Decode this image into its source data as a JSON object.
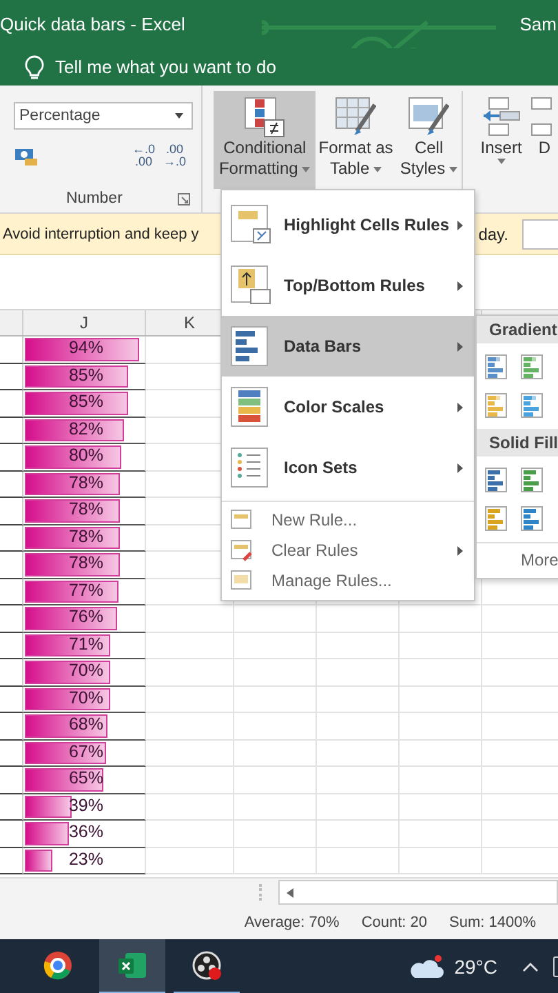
{
  "window": {
    "title": "Quick data bars  -  Excel",
    "user": "Sam"
  },
  "tell_me": {
    "placeholder": "Tell me what you want to do"
  },
  "ribbon": {
    "number_format": {
      "value": "Percentage"
    },
    "decimal_buttons": [
      {
        "top": "←.0",
        "bottom": ".00"
      },
      {
        "top": ".00",
        "bottom": "→.0"
      }
    ],
    "group_label": "Number",
    "buttons": [
      {
        "kind": "cf",
        "line1": "Conditional",
        "line2": "Formatting",
        "selected": true
      },
      {
        "kind": "table",
        "line1": "Format as",
        "line2": "Table",
        "selected": false
      },
      {
        "kind": "styles",
        "line1": "Cell",
        "line2": "Styles",
        "selected": false
      },
      {
        "kind": "insert",
        "line1": "Insert",
        "selected": false
      },
      {
        "kind": "delete",
        "line1": "D",
        "selected": false
      }
    ]
  },
  "message_bar": {
    "text": "Avoid interruption and keep y",
    "text_end": "day."
  },
  "sheet": {
    "columns": [
      "J",
      "K"
    ],
    "rows": [
      {
        "value": "94%",
        "level": 0.94
      },
      {
        "value": "85%",
        "level": 0.85
      },
      {
        "value": "85%",
        "level": 0.85
      },
      {
        "value": "82%",
        "level": 0.82
      },
      {
        "value": "80%",
        "level": 0.8
      },
      {
        "value": "78%",
        "level": 0.78
      },
      {
        "value": "78%",
        "level": 0.78
      },
      {
        "value": "78%",
        "level": 0.78
      },
      {
        "value": "78%",
        "level": 0.78
      },
      {
        "value": "77%",
        "level": 0.77
      },
      {
        "value": "76%",
        "level": 0.76
      },
      {
        "value": "71%",
        "level": 0.71
      },
      {
        "value": "70%",
        "level": 0.7
      },
      {
        "value": "70%",
        "level": 0.7
      },
      {
        "value": "68%",
        "level": 0.68
      },
      {
        "value": "67%",
        "level": 0.67
      },
      {
        "value": "65%",
        "level": 0.65
      },
      {
        "value": "39%",
        "level": 0.39
      },
      {
        "value": "36%",
        "level": 0.36
      },
      {
        "value": "23%",
        "level": 0.23
      }
    ]
  },
  "menu": {
    "items": [
      {
        "kind": "highlight",
        "label": "Highlight Cells Rules",
        "submenu": true,
        "selected": false
      },
      {
        "kind": "topbottom",
        "label": "Top/Bottom Rules",
        "submenu": true,
        "selected": false
      },
      {
        "kind": "databars",
        "label": "Data Bars",
        "submenu": true,
        "selected": true
      },
      {
        "kind": "colorscales",
        "label": "Color Scales",
        "submenu": true,
        "selected": false
      },
      {
        "kind": "iconsets",
        "label": "Icon Sets",
        "submenu": true,
        "selected": false
      },
      {
        "kind": "newrule",
        "label": "New Rule...",
        "submenu": false,
        "selected": false
      },
      {
        "kind": "clearrules",
        "label": "Clear Rules",
        "submenu": true,
        "selected": false
      },
      {
        "kind": "managerules",
        "label": "Manage Rules...",
        "submenu": false,
        "selected": false
      }
    ]
  },
  "submenu": {
    "sections": [
      {
        "title": "Gradient",
        "styles": [
          {
            "color": "#5b8fc7"
          },
          {
            "color": "#63b363"
          },
          {
            "color": "#e8b84a"
          },
          {
            "color": "#4aa3df"
          }
        ]
      },
      {
        "title": "Solid Fill",
        "styles": [
          {
            "color": "#3d6fa8"
          },
          {
            "color": "#4a9e4a"
          },
          {
            "color": "#d9a520"
          },
          {
            "color": "#2e86c9"
          }
        ]
      }
    ],
    "more": "More"
  },
  "status_bar": {
    "items": [
      "Average: 70%",
      "Count: 20",
      "Sum: 1400%"
    ]
  },
  "taskbar": {
    "apps": [
      {
        "kind": "chrome",
        "selected": false,
        "running": false
      },
      {
        "kind": "excel",
        "selected": true,
        "running": true
      },
      {
        "kind": "obs",
        "selected": false,
        "running": true
      }
    ],
    "temperature": "29°C"
  }
}
